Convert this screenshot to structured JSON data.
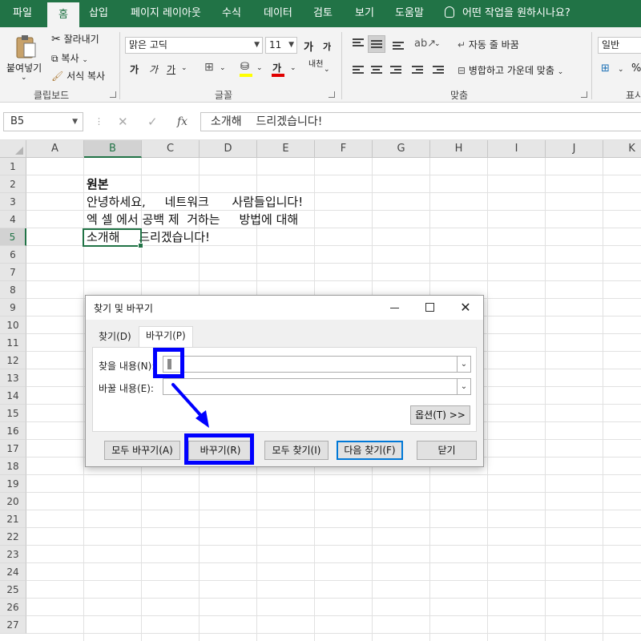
{
  "ribbon_tabs": [
    "파일",
    "홈",
    "삽입",
    "페이지 레이아웃",
    "수식",
    "데이터",
    "검토",
    "보기",
    "도움말"
  ],
  "tell_me": "어떤 작업을 원하시나요?",
  "clipboard": {
    "paste": "붙여넣기",
    "cut": "잘라내기",
    "copy": "복사",
    "format_painter": "서식 복사",
    "label": "클립보드"
  },
  "font": {
    "name": "맑은 고딕",
    "size": "11",
    "grow": "가",
    "shrink": "가",
    "bold": "가",
    "italic": "가",
    "underline": "가",
    "font_color": "가",
    "phonetic": "내천",
    "label": "글꼴"
  },
  "alignment": {
    "wrap_text": "자동 줄 바꿈",
    "merge_center": "병합하고 가운데 맞춤",
    "label": "맞춤"
  },
  "number": {
    "format": "일반",
    "label_partial": "표시"
  },
  "formula_bar": {
    "name_box": "B5",
    "fx": "fx",
    "content": "소개해    드리겠습니다!"
  },
  "grid": {
    "columns": [
      "A",
      "B",
      "C",
      "D",
      "E",
      "F",
      "G",
      "H",
      "I",
      "J",
      "K"
    ],
    "rows": [
      "1",
      "2",
      "3",
      "4",
      "5",
      "6",
      "7",
      "8",
      "9",
      "10",
      "11",
      "12",
      "13",
      "14",
      "15",
      "16",
      "17",
      "18",
      "19",
      "20",
      "21",
      "22",
      "23",
      "24",
      "25",
      "26",
      "27"
    ],
    "active_cell": "B5",
    "cells": {
      "B2": "원본",
      "B3": "안녕하세요,     네트워크      사람들입니다!",
      "B4": "엑 셀 에서 공백 제  거하는     방법에 대해",
      "B5": "소개해     드리겠습니다!"
    }
  },
  "dialog": {
    "title": "찾기 및 바꾸기",
    "tab_find": "찾기(D)",
    "tab_replace": "바꾸기(P)",
    "find_label": "찾을 내용(N):",
    "replace_label": "바꿀 내용(E):",
    "find_value": "",
    "replace_value": "",
    "options_button": "옵션(T) >>",
    "replace_all_button": "모두 바꾸기(A)",
    "replace_button": "바꾸기(R)",
    "find_all_button": "모두 찾기(I)",
    "find_next_button": "다음 찾기(F)",
    "close_button": "닫기"
  },
  "colors": {
    "excel_green": "#217346",
    "annotation_blue": "#0000ff"
  }
}
